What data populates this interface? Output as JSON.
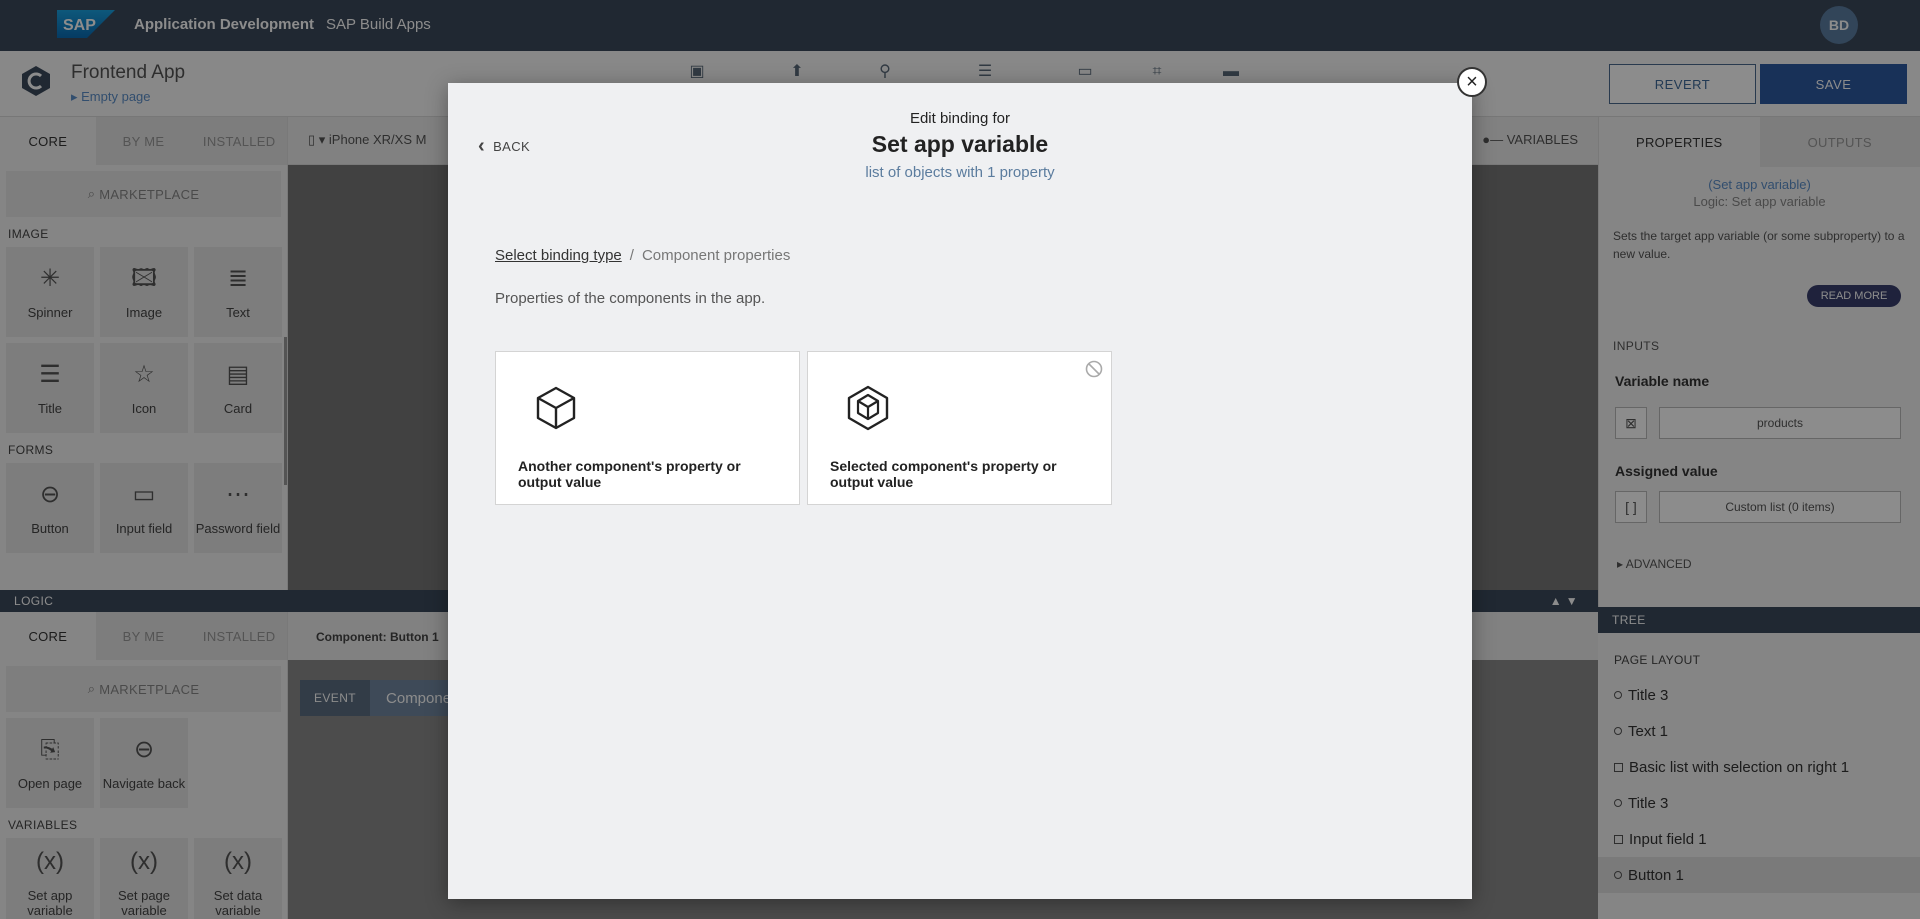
{
  "topbar": {
    "logo_text": "SAP",
    "title": "Application Development",
    "subtitle": "SAP Build Apps",
    "avatar": "BD"
  },
  "app": {
    "name": "Frontend App",
    "page": "Empty page",
    "revert": "REVERT",
    "save": "SAVE"
  },
  "components": {
    "tabs": [
      "CORE",
      "BY ME",
      "INSTALLED"
    ],
    "marketplace": "MARKETPLACE",
    "categories": {
      "image": "IMAGE",
      "forms": "FORMS"
    },
    "image_items": [
      "Spinner",
      "Image",
      "Text",
      "Title",
      "Icon",
      "Card"
    ],
    "forms_items": [
      "Button",
      "Input field",
      "Password field"
    ]
  },
  "canvas": {
    "device": "iPhone XR/XS M",
    "variables": "VARIABLES"
  },
  "properties": {
    "tabs": [
      "PROPERTIES",
      "OUTPUTS"
    ],
    "binding": "(Set app variable)",
    "logic": "Logic: Set app variable",
    "description": "Sets the target app variable (or some subproperty) to a new value.",
    "read_more": "READ MORE",
    "inputs_header": "INPUTS",
    "variable_name_label": "Variable name",
    "variable_name_value": "products",
    "assigned_value_label": "Assigned value",
    "assigned_value_value": "Custom list (0 items)",
    "advanced": "ADVANCED"
  },
  "logic": {
    "header": "LOGIC",
    "tabs": [
      "CORE",
      "BY ME",
      "INSTALLED"
    ],
    "marketplace": "MARKETPLACE",
    "items": [
      "Open page",
      "Navigate back"
    ],
    "variables_header": "VARIABLES",
    "variable_items": [
      "Set app variable",
      "Set page variable",
      "Set data variable"
    ],
    "component_label": "Component: Button 1",
    "event_label": "EVENT",
    "event_component": "Compone"
  },
  "tree": {
    "header": "TREE",
    "layout_label": "PAGE LAYOUT",
    "items": [
      {
        "label": "Title 3",
        "kind": "dot"
      },
      {
        "label": "Text 1",
        "kind": "dot"
      },
      {
        "label": "Basic list with selection on right 1",
        "kind": "square"
      },
      {
        "label": "Title 3",
        "kind": "dot"
      },
      {
        "label": "Input field 1",
        "kind": "square"
      },
      {
        "label": "Button 1",
        "kind": "dot",
        "selected": true
      }
    ]
  },
  "modal": {
    "back": "BACK",
    "pre_title": "Edit binding for",
    "title": "Set app variable",
    "subtitle": "list of objects with 1 property",
    "breadcrumb_link": "Select binding type",
    "breadcrumb_sep": "/",
    "breadcrumb_current": "Component properties",
    "description": "Properties of the components in the app.",
    "cards": [
      {
        "label": "Another component's property or output value",
        "icon": "cube-icon",
        "disabled": false
      },
      {
        "label": "Selected component's property or output value",
        "icon": "cube-selected-icon",
        "disabled": true
      }
    ]
  },
  "colors": {
    "topbar": "#3b4a5c",
    "save": "#2d5aa0",
    "link": "#5b8ec9"
  }
}
